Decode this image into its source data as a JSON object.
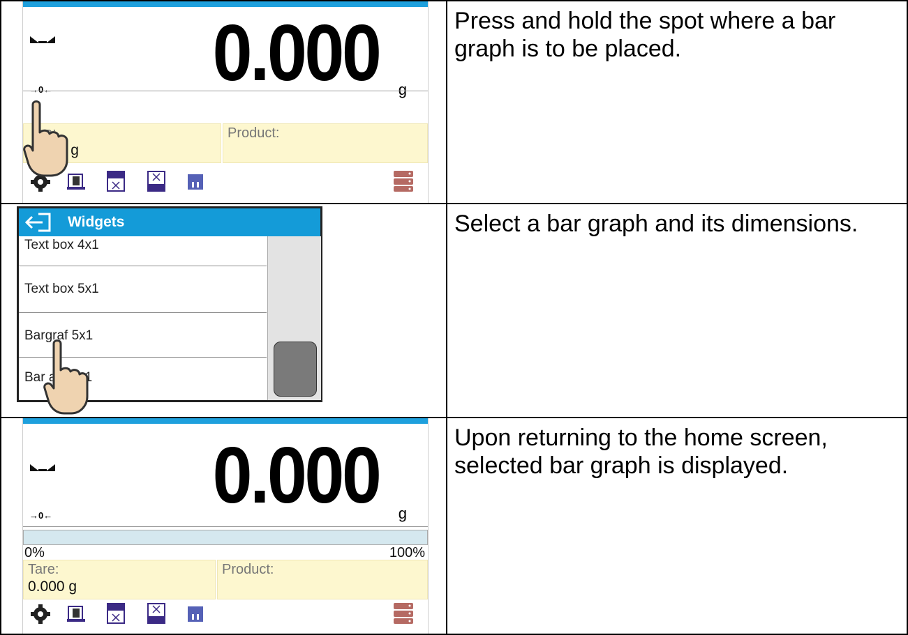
{
  "rows": [
    {
      "instruction": "Press and hold the spot where a bar graph is to be placed.",
      "screen": {
        "reading": "0.000",
        "unit": "g",
        "zero_indicator": "→0←",
        "tare_label": "e:",
        "tare_value": "00 g",
        "product_label": "Product:"
      }
    },
    {
      "instruction": "Select a bar graph and its dimensions.",
      "dialog": {
        "title": "Widgets",
        "items": [
          "Text box 4x1",
          "Text box 5x1",
          "Bargraf 5x1",
          "Bar af 10x1"
        ]
      }
    },
    {
      "instruction": "Upon returning to the home screen, selected bar graph is displayed.",
      "screen": {
        "reading": "0.000",
        "unit": "g",
        "zero_indicator": "→0←",
        "bar_min": "0%",
        "bar_max": "100%",
        "tare_label": "Tare:",
        "tare_value": "0.000 g",
        "product_label": "Product:"
      }
    }
  ],
  "icons": [
    "settings-gear-icon",
    "tare-weight-icon",
    "min-threshold-icon",
    "max-threshold-icon",
    "bar-chart-icon",
    "database-icon"
  ],
  "colors": {
    "accent": "#149bd8",
    "info_box": "#fdf7cf",
    "toolbar_icon": "#3b2a85",
    "database_icon": "#b56a63"
  }
}
